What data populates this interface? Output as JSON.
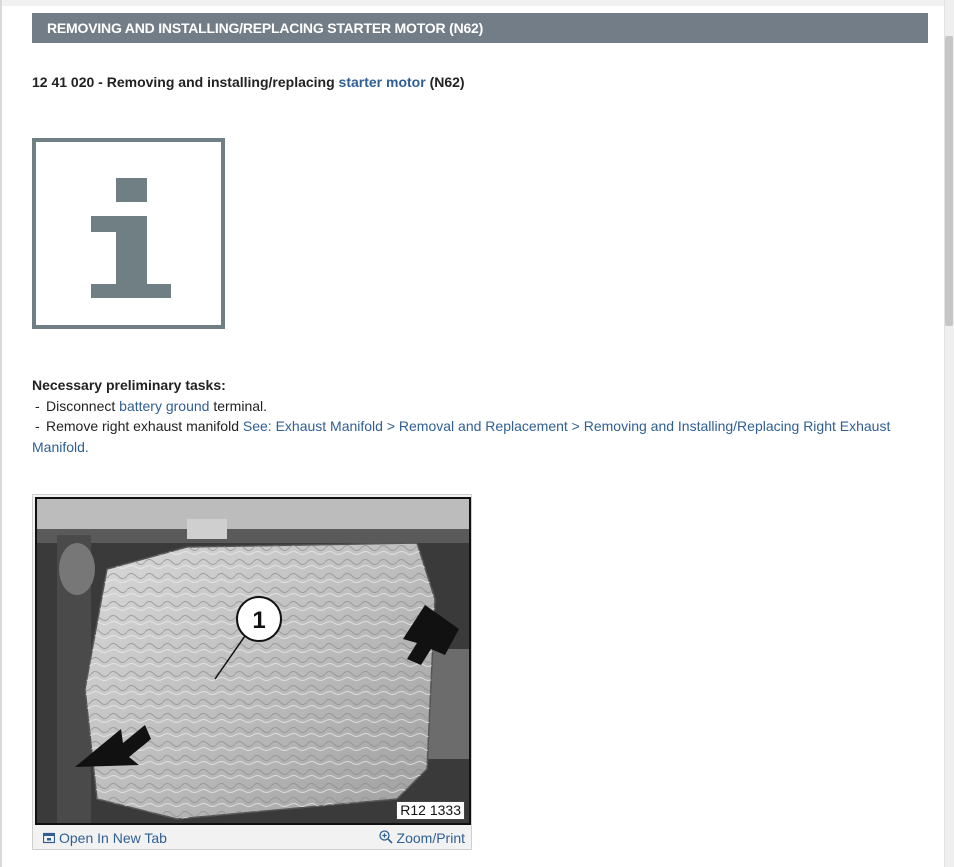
{
  "document": {
    "title_bar": "REMOVING AND INSTALLING/REPLACING STARTER MOTOR (N62)",
    "subtitle_prefix": "12 41 020 - Removing and installing/replacing ",
    "subtitle_link": "starter motor",
    "subtitle_suffix": " (N62)"
  },
  "info_icon": {
    "name": "info-icon",
    "color": "#6f7f83"
  },
  "preliminary": {
    "heading": "Necessary preliminary tasks:",
    "dash": "-",
    "items": [
      {
        "prefix": "Disconnect ",
        "link": "battery ground",
        "suffix": " terminal."
      },
      {
        "prefix": "Remove right exhaust manifold ",
        "link": "See: Exhaust Manifold > Removal and Replacement > Removing and Installing/Replacing Right Exhaust Manifold.",
        "suffix": ""
      }
    ]
  },
  "figure": {
    "callout": "1",
    "label": "R12 1333",
    "open_tab": "Open In New Tab",
    "zoom": "Zoom/Print"
  },
  "colors": {
    "title_bar_bg": "#737d87",
    "link": "#2f5f94"
  }
}
